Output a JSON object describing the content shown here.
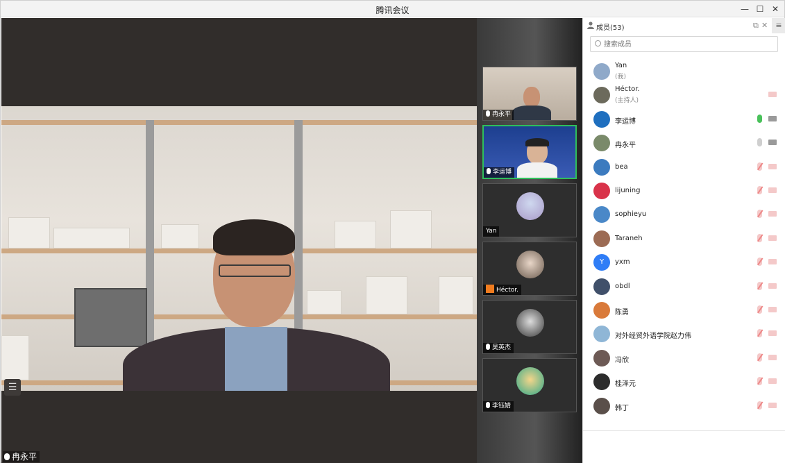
{
  "window": {
    "title": "腾讯会议",
    "controls": [
      "—",
      "☐",
      "✕"
    ]
  },
  "stage": {
    "speaker_name": "冉永平",
    "list_icon": "☰"
  },
  "strip": {
    "tiles": [
      {
        "name": "冉永平",
        "mic": "on"
      },
      {
        "name": "李运博",
        "mic": "on",
        "active": true
      },
      {
        "name": "Yan"
      },
      {
        "name": "Héctor.",
        "host_badge": true
      },
      {
        "name": "吴英杰",
        "mic": "muted"
      },
      {
        "name": "李钰婧",
        "mic": "muted"
      }
    ]
  },
  "panel": {
    "title": "成员(53)",
    "search_placeholder": "搜索成员",
    "members": [
      {
        "name": "Yan",
        "role": "(我)",
        "color": "#8fa9c9"
      },
      {
        "name": "Héctor.",
        "role": "(主持人)",
        "color": "#6c6a5c",
        "cam": "muted"
      },
      {
        "name": "李运博",
        "color": "#1f6fbf",
        "mic": "on",
        "cam": "idle"
      },
      {
        "name": "冉永平",
        "color": "#7a8a6a",
        "mic": "idle",
        "cam": "idle"
      },
      {
        "name": "bea",
        "color": "#3c7bbf",
        "mic": "muted",
        "cam": "muted"
      },
      {
        "name": "lijuning",
        "color": "#d9334a",
        "mic": "muted",
        "cam": "muted"
      },
      {
        "name": "sophieyu",
        "color": "#4a88c8",
        "mic": "muted",
        "cam": "muted"
      },
      {
        "name": "Taraneh",
        "color": "#9c6b54",
        "mic": "muted",
        "cam": "muted"
      },
      {
        "name": "yxm",
        "color": "#2f7df6",
        "avatar_text": "Y",
        "mic": "muted",
        "cam": "muted"
      },
      {
        "name": "obdl",
        "color": "#40506a",
        "mic": "muted",
        "cam": "muted"
      },
      {
        "name": "陈勇",
        "color": "#d97a3a",
        "mic": "muted",
        "cam": "muted"
      },
      {
        "name": "对外经贸外语学院赵力伟",
        "color": "#8fb6d6",
        "mic": "muted",
        "cam": "muted"
      },
      {
        "name": "冯欣",
        "color": "#6d5a55",
        "mic": "muted",
        "cam": "muted"
      },
      {
        "name": "桂泽元",
        "color": "#2c2c2c",
        "mic": "muted",
        "cam": "muted"
      },
      {
        "name": "韩丁",
        "color": "#5a4f4a",
        "mic": "muted",
        "cam": "muted"
      }
    ]
  }
}
